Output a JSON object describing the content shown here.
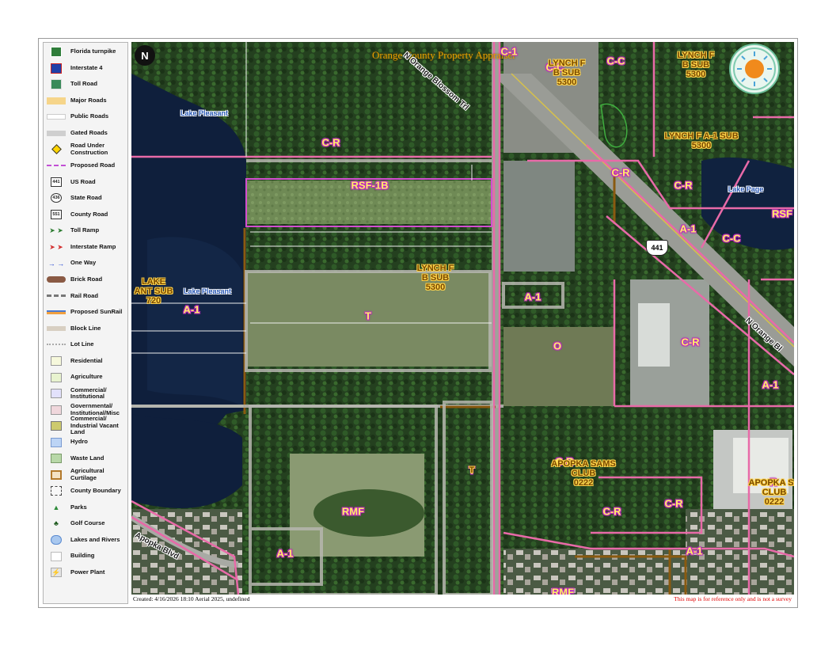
{
  "map": {
    "title": "Orange County Property Appraiser",
    "north_label": "N",
    "footer_left": "Created: 4/16/2026 18:10   Aerial 2025, undefined",
    "footer_right": "This map is for reference only and is not a survey",
    "shield_441": "441"
  },
  "legend": {
    "items": [
      {
        "label": "Florida turnpike",
        "icon": "turnpike-shield-icon"
      },
      {
        "label": "Interstate 4",
        "icon": "interstate-shield-icon"
      },
      {
        "label": "Toll Road",
        "icon": "toll-road-shield-icon"
      },
      {
        "label": "Major Roads",
        "icon": "major-road-swatch"
      },
      {
        "label": "Public Roads",
        "icon": "public-road-swatch"
      },
      {
        "label": "Gated Roads",
        "icon": "gated-road-swatch"
      },
      {
        "label": "Road Under Construction",
        "icon": "construction-icon"
      },
      {
        "label": "Proposed Road",
        "icon": "proposed-road-swatch"
      },
      {
        "label": "US Road",
        "icon": "us-road-shield-icon",
        "glyph": "441"
      },
      {
        "label": "State Road",
        "icon": "state-road-shield-icon",
        "glyph": "436"
      },
      {
        "label": "County Road",
        "icon": "county-road-shield-icon",
        "glyph": "551"
      },
      {
        "label": "Toll Ramp",
        "icon": "toll-ramp-arrows-icon"
      },
      {
        "label": "Interstate Ramp",
        "icon": "interstate-ramp-arrows-icon"
      },
      {
        "label": "One Way",
        "icon": "one-way-arrows-icon"
      },
      {
        "label": "Brick Road",
        "icon": "brick-road-swatch"
      },
      {
        "label": "Rail Road",
        "icon": "rail-road-swatch"
      },
      {
        "label": "Proposed SunRail",
        "icon": "sunrail-swatch"
      },
      {
        "label": "Block Line",
        "icon": "block-line-swatch"
      },
      {
        "label": "Lot Line",
        "icon": "lot-line-swatch"
      },
      {
        "label": "Residential",
        "icon": "residential-swatch"
      },
      {
        "label": "Agriculture",
        "icon": "agriculture-swatch"
      },
      {
        "label": "Commercial/ Institutional",
        "icon": "commercial-swatch"
      },
      {
        "label": "Governmental/ Institutional/Misc",
        "icon": "governmental-swatch"
      },
      {
        "label": "Commercial/ Industrial Vacant Land",
        "icon": "vacant-land-swatch"
      },
      {
        "label": "Hydro",
        "icon": "hydro-swatch"
      },
      {
        "label": "Waste Land",
        "icon": "waste-land-swatch"
      },
      {
        "label": "Agricultural Curtilage",
        "icon": "curtilage-swatch"
      },
      {
        "label": "County Boundary",
        "icon": "county-boundary-swatch"
      },
      {
        "label": "Parks",
        "icon": "park-tree-icon"
      },
      {
        "label": "Golf Course",
        "icon": "golf-course-icon"
      },
      {
        "label": "Lakes and Rivers",
        "icon": "lake-icon"
      },
      {
        "label": "Building",
        "icon": "building-swatch"
      },
      {
        "label": "Power Plant",
        "icon": "power-plant-icon"
      }
    ]
  },
  "labels": {
    "zoning": [
      "C-1",
      "C-C",
      "C-C",
      "C-R",
      "RSF-1B",
      "C-R",
      "C-R",
      "A-1",
      "C-C",
      "RSF",
      "A-1",
      "T",
      "A-1",
      "O",
      "C-R",
      "A-1",
      "T",
      "C-R",
      "C-R",
      "C-R",
      "R",
      "RMF",
      "A-1",
      "RMF",
      "A-1"
    ],
    "subdivisions": [
      "LYNCH F\nB SUB\n5300",
      "LYNCH F\nB SUB\n5300",
      "LYNCH F A-1 SUB\n5300",
      "LYNCH F\nB SUB\n5300",
      "LAKE\nANT SUB\n720",
      "APOPKA SAMS\nCLUB\n0222",
      "APOPKA SA\nCLUB\n0222",
      "T"
    ],
    "water": [
      "Lake Pleasant",
      "Lake Pleasant",
      "Lake Page"
    ],
    "roads": [
      "N Orange Blossom Trl",
      "N Orange Bl",
      "Apopka Blvd"
    ]
  }
}
